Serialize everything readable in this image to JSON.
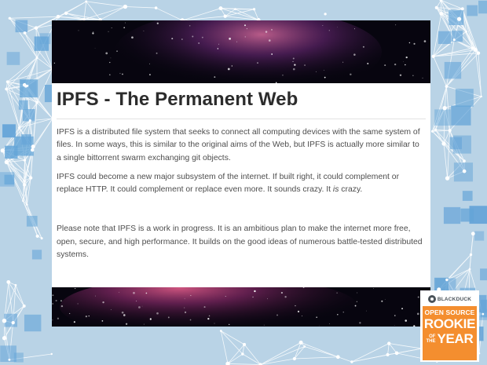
{
  "page": {
    "title": "IPFS - The Permanent Web",
    "paragraphs": [
      "IPFS is a distributed file system that seeks to connect all computing devices with the same system of files. In some ways, this is similar to the original aims of the Web, but IPFS is actually more similar to a single bittorrent swarm exchanging git objects.",
      "IPFS could become a new major subsystem of the internet. If built right, it could complement or replace HTTP. It could complement or replace even more. It sounds crazy. It ",
      "Please note that IPFS is a work in progress. It is an ambitious plan to make the internet more free, open, secure, and high performance. It builds on the good ideas of numerous battle-tested distributed systems."
    ],
    "emphasis": "is",
    "emphasis_tail": " crazy."
  },
  "badge": {
    "brand": "BLACKDUCK",
    "line1": "OPEN SOURCE",
    "line2": "ROOKIE",
    "of": "OF",
    "the": "THE",
    "line3": "YEAR"
  },
  "colors": {
    "background": "#b9d3e6",
    "network_node": "#5b9fd6",
    "badge_orange": "#f48e2f",
    "title_text": "#2c2c2c",
    "body_text": "#4d4d4d"
  },
  "icons": [
    "blackduck-logo-icon"
  ]
}
